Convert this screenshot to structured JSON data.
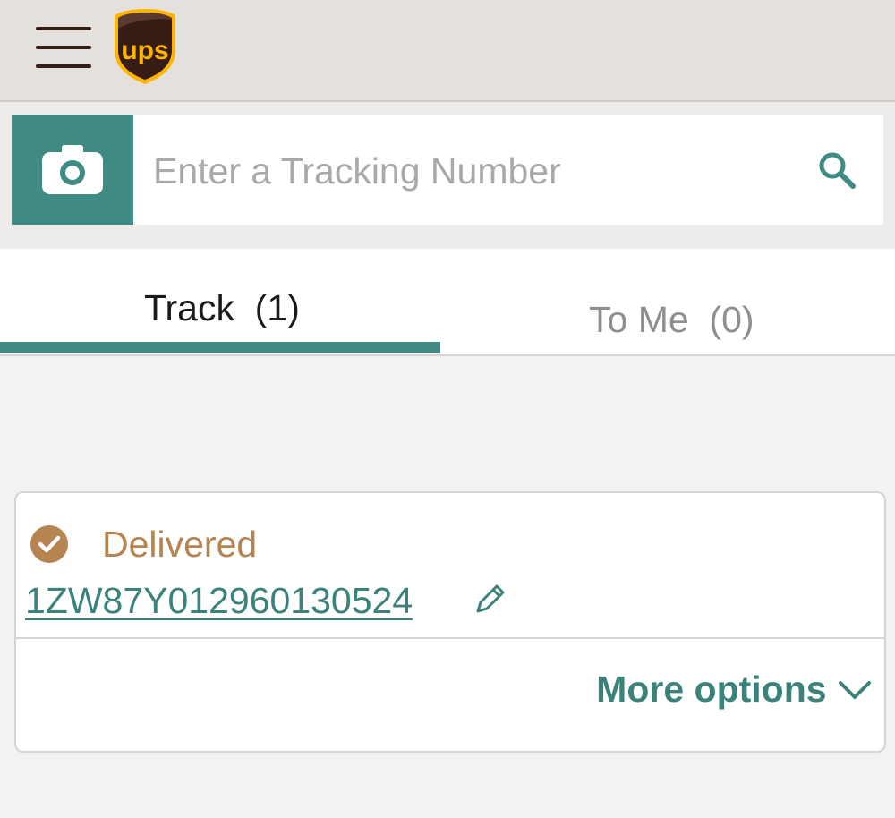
{
  "header": {
    "logo_text": "ups"
  },
  "search": {
    "placeholder": "Enter a Tracking Number"
  },
  "tabs": [
    {
      "label": "Track  (1)",
      "active": true
    },
    {
      "label": "To Me  (0)",
      "active": false
    }
  ],
  "shipment": {
    "status": "Delivered",
    "tracking_number": "1ZW87Y012960130524",
    "more_options_label": "More options"
  },
  "icons": {
    "menu": "hamburger-icon",
    "camera": "camera-icon",
    "search": "search-icon",
    "status": "check-circle-icon",
    "edit": "pencil-icon",
    "expand": "chevron-down-icon"
  },
  "colors": {
    "accent": "#3f8a82",
    "brand_brown": "#351c15",
    "brand_gold": "#ffb500",
    "status_delivered": "#b58450"
  }
}
